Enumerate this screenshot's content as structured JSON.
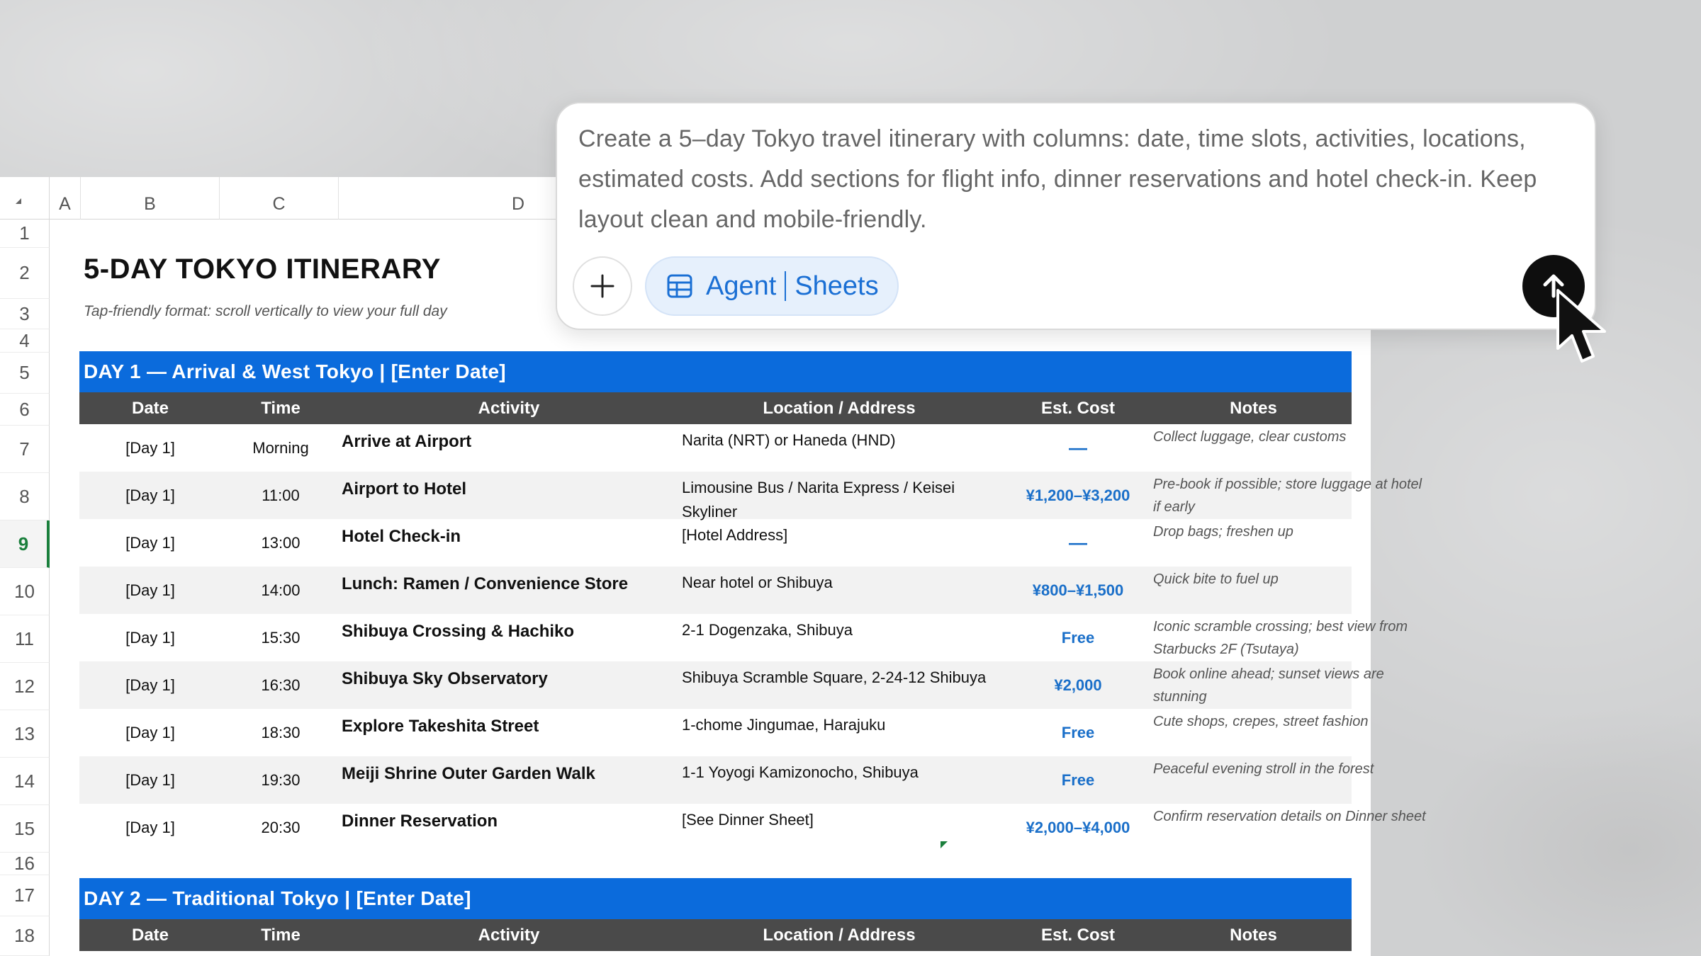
{
  "sheet": {
    "columns": [
      "A",
      "B",
      "C",
      "D"
    ],
    "rows": [
      "1",
      "2",
      "3",
      "4",
      "5",
      "6",
      "7",
      "8",
      "9",
      "10",
      "11",
      "12",
      "13",
      "14",
      "15",
      "16",
      "17",
      "18"
    ],
    "active_row": "9",
    "title": "5-DAY TOKYO ITINERARY",
    "subtitle": "Tap-friendly format: scroll vertically to view your full day",
    "table_headers": [
      "Date",
      "Time",
      "Activity",
      "Location / Address",
      "Est. Cost",
      "Notes"
    ],
    "day1": {
      "banner": "DAY 1 — Arrival & West Tokyo  |  [Enter Date]",
      "rows": [
        {
          "date": "[Day 1]",
          "time": "Morning",
          "activity": "Arrive at Airport",
          "location": "Narita (NRT) or Haneda (HND)",
          "cost": "—",
          "notes": "Collect luggage, clear customs"
        },
        {
          "date": "[Day 1]",
          "time": "11:00",
          "activity": "Airport to Hotel",
          "location": "Limousine Bus / Narita Express / Keisei Skyliner",
          "cost": "¥1,200–¥3,200",
          "notes": "Pre-book if possible; store luggage at hotel if early"
        },
        {
          "date": "[Day 1]",
          "time": "13:00",
          "activity": "Hotel Check-in",
          "location": "[Hotel Address]",
          "cost": "—",
          "notes": "Drop bags; freshen up"
        },
        {
          "date": "[Day 1]",
          "time": "14:00",
          "activity": "Lunch: Ramen / Convenience Store",
          "location": "Near hotel or Shibuya",
          "cost": "¥800–¥1,500",
          "notes": "Quick bite to fuel up"
        },
        {
          "date": "[Day 1]",
          "time": "15:30",
          "activity": "Shibuya Crossing & Hachiko",
          "location": "2-1 Dogenzaka, Shibuya",
          "cost": "Free",
          "notes": "Iconic scramble crossing; best view from Starbucks 2F (Tsutaya)"
        },
        {
          "date": "[Day 1]",
          "time": "16:30",
          "activity": "Shibuya Sky Observatory",
          "location": "Shibuya Scramble Square, 2-24-12 Shibuya",
          "cost": "¥2,000",
          "notes": "Book online ahead; sunset views are stunning"
        },
        {
          "date": "[Day 1]",
          "time": "18:30",
          "activity": "Explore Takeshita Street",
          "location": "1-chome Jingumae, Harajuku",
          "cost": "Free",
          "notes": "Cute shops, crepes, street fashion"
        },
        {
          "date": "[Day 1]",
          "time": "19:30",
          "activity": "Meiji Shrine Outer Garden Walk",
          "location": "1-1 Yoyogi Kamizonocho, Shibuya",
          "cost": "Free",
          "notes": "Peaceful evening stroll in the forest"
        },
        {
          "date": "[Day 1]",
          "time": "20:30",
          "activity": "Dinner Reservation",
          "location": "[See Dinner Sheet]",
          "cost": "¥2,000–¥4,000",
          "notes": "Confirm reservation details on Dinner sheet"
        }
      ]
    },
    "day2": {
      "banner": "DAY 2 — Traditional Tokyo  |  [Enter Date]"
    }
  },
  "prompt": {
    "text": "Create a 5–day Tokyo travel itinerary with columns: date, time slots, activities, locations, estimated costs. Add sections for flight info, dinner reservations and hotel check-in. Keep layout clean and mobile-friendly.",
    "chip_label_1": "Agent",
    "chip_label_2": "Sheets",
    "plus_icon": "plus-icon",
    "send_icon": "arrow-up-icon",
    "accent": "#1a6fd4"
  },
  "colors": {
    "banner": "#0b6bdc",
    "table_header": "#4a4a4a",
    "cost": "#1a6fc9"
  }
}
